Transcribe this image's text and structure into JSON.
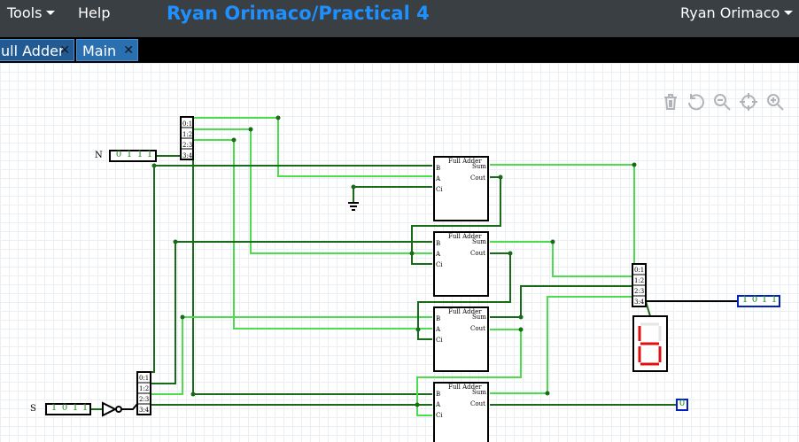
{
  "menu": {
    "tools": "Tools",
    "help": "Help",
    "user": "Ryan Orimaco"
  },
  "project_title": "Ryan Orimaco/Practical 4",
  "tabs": [
    {
      "label": "ull Adder",
      "close": "✕"
    },
    {
      "label": "Main",
      "close": "✕"
    }
  ],
  "toolbar": [
    "trash-icon",
    "undo-icon",
    "zoom-out-icon",
    "center-icon",
    "zoom-in-icon"
  ],
  "colors": {
    "wire_on": "#4ddc4d",
    "wire_off": "#1a6a1a",
    "accent": "#1e90ff",
    "display_segment": "#e01010"
  },
  "circuit": {
    "input_n": {
      "label": "N",
      "bits": [
        "0",
        "1",
        "1",
        "1"
      ]
    },
    "input_s": {
      "label": "S",
      "bits": [
        "1",
        "0",
        "1",
        "1"
      ]
    },
    "splitter_labels": [
      "0:1",
      "1:2",
      "2:3",
      "3:4"
    ],
    "full_adder": {
      "title": "Full Adder",
      "ports_in": [
        "B",
        "A",
        "Ci"
      ],
      "ports_out": [
        "Sum",
        "Cout"
      ]
    },
    "output_sum": {
      "bits": [
        "1",
        "0",
        "1",
        "1"
      ]
    },
    "output_carry": {
      "bits": [
        "0"
      ]
    },
    "seven_segment": {
      "digit": "6"
    }
  }
}
